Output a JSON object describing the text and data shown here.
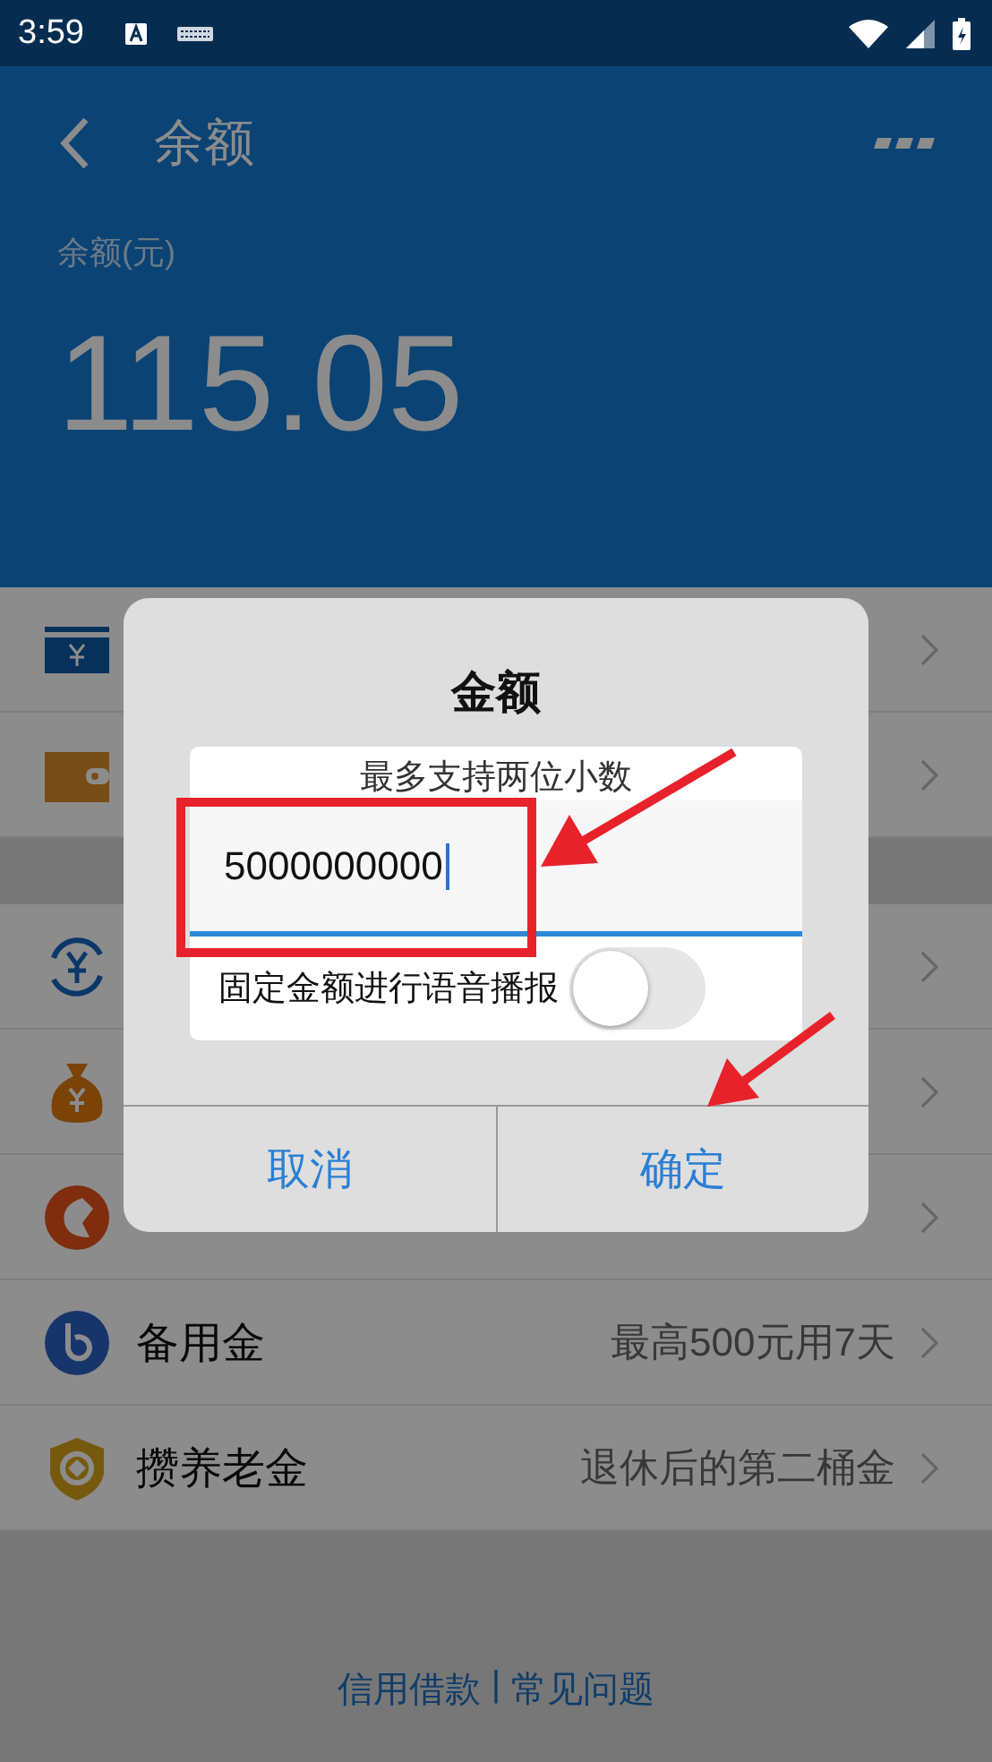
{
  "status_bar": {
    "time": "3:59"
  },
  "header": {
    "title": "余额",
    "balance_label": "余额(元)",
    "balance": "115.05"
  },
  "groups": [
    {
      "rows": [
        {
          "kind": "card"
        },
        {
          "kind": "wallet"
        }
      ]
    },
    {
      "rows": [
        {
          "kind": "cycle"
        },
        {
          "kind": "bag"
        },
        {
          "kind": "orange"
        },
        {
          "kind": "bcircle",
          "title": "备用金",
          "sub": "最高500元用7天"
        },
        {
          "kind": "shield",
          "title": "攒养老金",
          "sub": "退休后的第二桶金"
        }
      ]
    }
  ],
  "footer": {
    "links": [
      "信用借款",
      "常见问题"
    ],
    "separator": "|"
  },
  "dialog": {
    "title": "金额",
    "placeholder": "最多支持两位小数",
    "value": "5000000000",
    "toggle": {
      "label": "固定金额进行语音播报",
      "checked": false
    },
    "buttons": [
      "取消",
      "确定"
    ]
  }
}
